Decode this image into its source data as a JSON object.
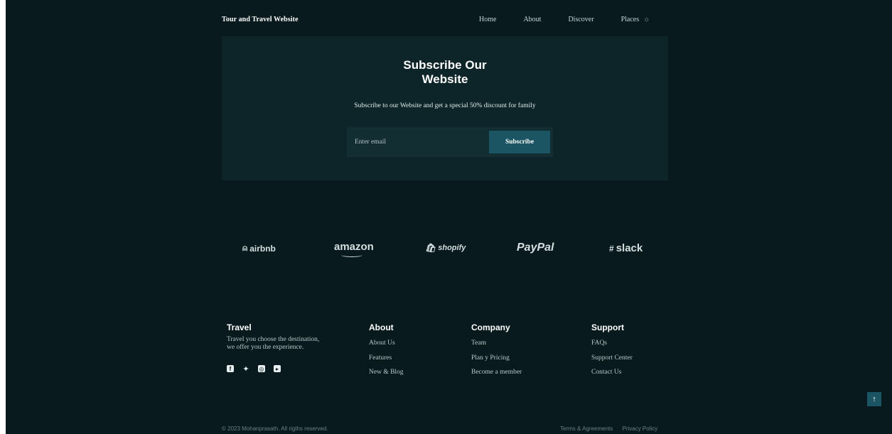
{
  "header": {
    "logo": "Tour and Travel Website",
    "nav": [
      "Home",
      "About",
      "Discover",
      "Places"
    ],
    "theme_icon": "sun-icon"
  },
  "subscribe": {
    "title": "Subscribe Our Website",
    "description": "Subscribe to our Website and get a special 50% discount for family",
    "placeholder": "Enter email",
    "button": "Subscribe"
  },
  "brands": [
    "airbnb",
    "amazon",
    "shopify",
    "PayPal",
    "slack"
  ],
  "footer": {
    "travel": {
      "title": "Travel",
      "description": "Travel you choose the destination, we offer you the experience.",
      "socials": [
        "facebook-icon",
        "twitter-icon",
        "instagram-icon",
        "youtube-icon"
      ]
    },
    "about": {
      "title": "About",
      "links": [
        "About Us",
        "Features",
        "New & Blog"
      ]
    },
    "company": {
      "title": "Company",
      "links": [
        "Team",
        "Plan y Pricing",
        "Become a member"
      ]
    },
    "support": {
      "title": "Support",
      "links": [
        "FAQs",
        "Support Center",
        "Contact Us"
      ]
    }
  },
  "bottom": {
    "copyright": "© 2023 Mohanprasath. All rigths reserved.",
    "terms": "Terms & Agreements",
    "privacy": "Privacy Policy"
  },
  "scroll_top_icon": "arrow-up-icon",
  "colors": {
    "background": "#081a1d",
    "panel": "#0d2529",
    "accent": "#1b5563"
  }
}
